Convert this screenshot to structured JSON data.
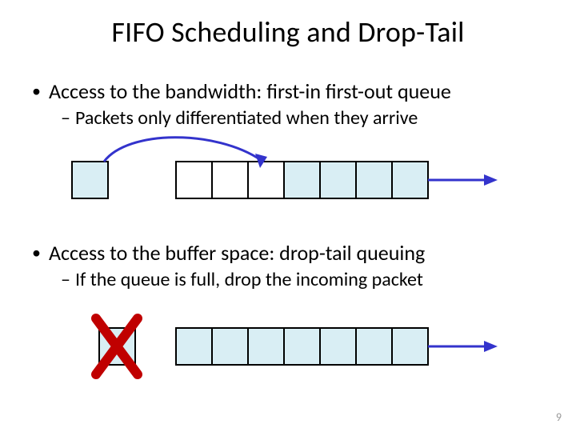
{
  "title": "FIFO Scheduling and Drop-Tail",
  "bullets": {
    "b1": "Access to the bandwidth: first-in first-out queue",
    "b1_sub": "Packets only differentiated when they arrive",
    "b2": "Access to the buffer space: drop-tail queuing",
    "b2_sub": "If the queue is full, drop the incoming packet"
  },
  "page_number": "9",
  "diagram": {
    "fifo": {
      "incoming_box": 1,
      "queue_boxes": 7,
      "filled_boxes_from_right": 4
    },
    "drop_tail": {
      "incoming_box": 1,
      "queue_boxes": 7,
      "filled_boxes_from_right": 7,
      "drop_marker": "X"
    },
    "colors": {
      "box_fill": "#d9eef4",
      "box_stroke": "#000000",
      "arrow": "#3333cc",
      "x_mark": "#c00000"
    }
  }
}
